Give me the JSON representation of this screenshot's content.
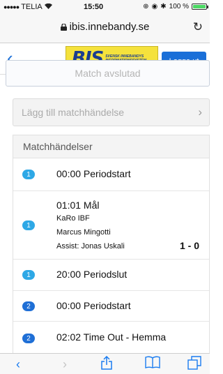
{
  "status_bar": {
    "carrier": "TELIA",
    "time": "15:50",
    "battery": "100 %",
    "battery_level": 1.0
  },
  "browser": {
    "url": "ibis.innebandy.se"
  },
  "header": {
    "logo_text": "BIS",
    "logo_subtitle": "SVENSK INNEBANDYS INFORMATIONSSYSTEM",
    "logout_label": "Logga ut"
  },
  "match": {
    "status_label": "Match avslutad",
    "add_event_label": "Lägg till matchhändelse"
  },
  "events": {
    "title": "Matchhändelser",
    "items": [
      {
        "period": "1",
        "text": "00:00 Periodstart"
      },
      {
        "period": "1",
        "text": "01:01 Mål",
        "team": "KaRo IBF",
        "player": "Marcus Mingotti",
        "assist": "Assist: Jonas Uskali",
        "score": "1 - 0"
      },
      {
        "period": "1",
        "text": "20:00 Periodslut"
      },
      {
        "period": "2",
        "text": "00:00 Periodstart"
      },
      {
        "period": "2",
        "text": "02:02 Time Out - Hemma"
      }
    ]
  },
  "colors": {
    "accent": "#1a6fd8",
    "period1_badge": "#2ea8e6",
    "period2_badge": "#1f6fd6",
    "logo_yellow": "#f5e23c"
  }
}
